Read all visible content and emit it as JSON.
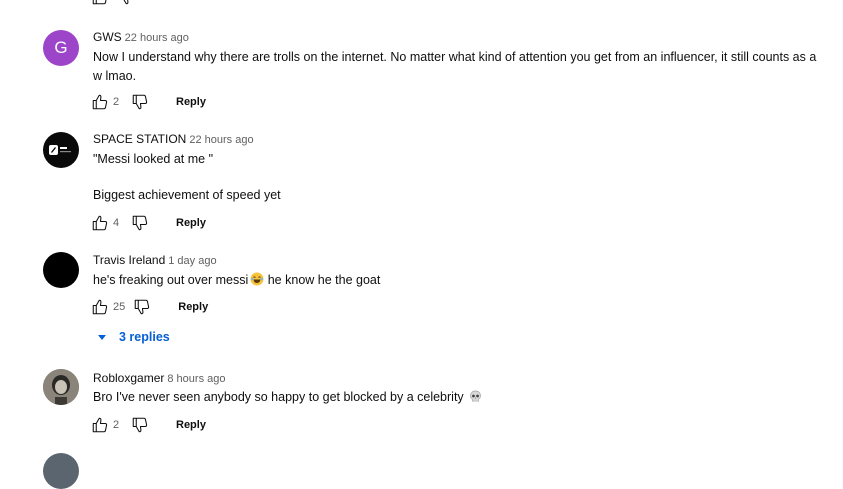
{
  "comments": [
    {
      "author": "GWS",
      "time": "22 hours ago",
      "avatar_letter": "G",
      "avatar_color": "#9c45c9",
      "lines": [
        "Now I understand why there are trolls on the internet. No matter what kind of attention you get from an influencer, it still counts as a",
        "w lmao."
      ],
      "likes": "2",
      "reply_label": "Reply"
    },
    {
      "author": "SPACE STATION",
      "time": "22 hours ago",
      "lines": [
        "\"Messi looked at me \"",
        "Biggest achievement of speed yet"
      ],
      "likes": "4",
      "reply_label": "Reply"
    },
    {
      "author": "Travis Ireland",
      "time": "1 day ago",
      "lines": [
        "he's freaking out over messi",
        "he know he the goat"
      ],
      "emoji": "laughing-crying-emoji",
      "likes": "25",
      "reply_label": "Reply",
      "replies_label": "3 replies"
    },
    {
      "author": "Robloxgamer",
      "time": "8 hours ago",
      "lines": [
        "Bro I've never seen anybody so happy to get blocked by a celebrity"
      ],
      "emoji": "skull-emoji",
      "likes": "2",
      "reply_label": "Reply"
    }
  ],
  "colors": {
    "link_blue": "#065fd4",
    "secondary_text": "#606060"
  }
}
